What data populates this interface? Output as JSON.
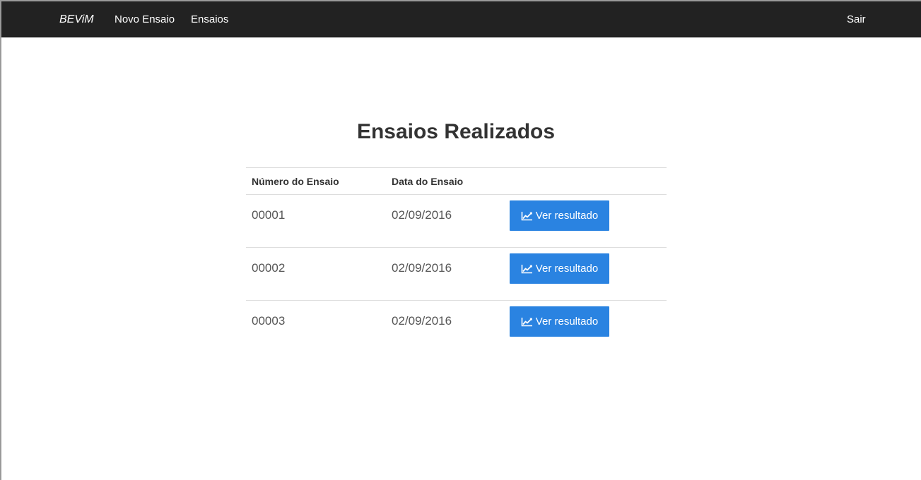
{
  "navbar": {
    "brand": "BEViM",
    "items": [
      {
        "label": "Novo Ensaio"
      },
      {
        "label": "Ensaios"
      }
    ],
    "logout": "Sair"
  },
  "page": {
    "title": "Ensaios Realizados"
  },
  "table": {
    "headers": [
      "Número do Ensaio",
      "Data do Ensaio",
      ""
    ],
    "rows": [
      {
        "numero": "00001",
        "data": "02/09/2016",
        "action": "Ver resultado"
      },
      {
        "numero": "00002",
        "data": "02/09/2016",
        "action": "Ver resultado"
      },
      {
        "numero": "00003",
        "data": "02/09/2016",
        "action": "Ver resultado"
      }
    ]
  },
  "icons": {
    "action_icon": "line-chart-icon"
  },
  "colors": {
    "navbar_bg": "#222222",
    "button_bg": "#2a83e1"
  }
}
